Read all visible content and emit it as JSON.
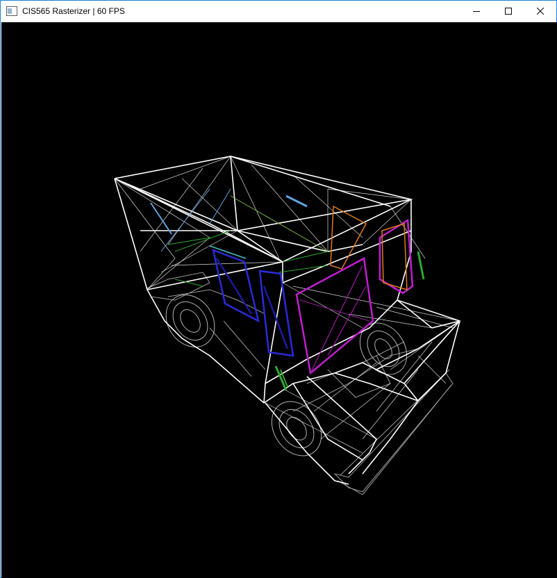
{
  "window": {
    "title": "CIS565 Rasterizer | 60 FPS",
    "icon": "app-window-icon",
    "border_color": "#1883d7"
  },
  "controls": {
    "minimize_icon": "minimize-icon",
    "maximize_icon": "maximize-icon",
    "close_icon": "close-icon"
  },
  "viewport": {
    "background": "#000000",
    "scene": "wireframe-truck",
    "colors": {
      "edges": "#ffffff",
      "chassis": "#9a9a9a",
      "windows_front": "#c21ecf",
      "windows_side": "#2a2ad8",
      "windows_rear": "#e07a1a",
      "accent_green": "#2fa82f",
      "accent_blue": "#5fa4e0"
    }
  }
}
